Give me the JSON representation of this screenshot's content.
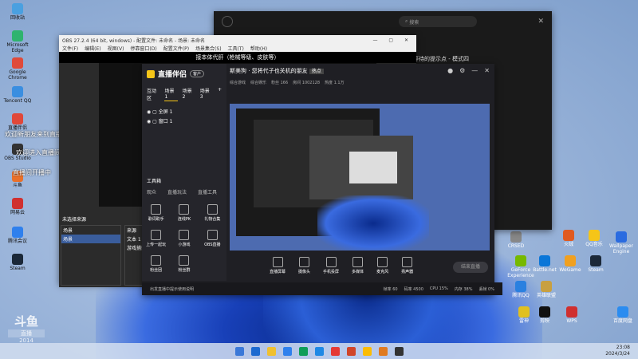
{
  "desktop": {
    "left_icons": [
      {
        "label": "回收站",
        "color": "#4aa0e0"
      },
      {
        "label": "Microsoft Edge",
        "color": "#2fb36f"
      },
      {
        "label": "Google Chrome",
        "color": "#e04a3a"
      },
      {
        "label": "Tencent QQ",
        "color": "#3a8ee0"
      },
      {
        "label": "直播伴侣",
        "color": "#e0483a"
      },
      {
        "label": "OBS Studio",
        "color": "#333333"
      },
      {
        "label": "斗鱼",
        "color": "#e8702a"
      },
      {
        "label": "网易云",
        "color": "#d03030"
      },
      {
        "label": "腾讯会议",
        "color": "#2f80ed"
      },
      {
        "label": "Steam",
        "color": "#1b2838"
      }
    ],
    "overlay_lines": [
      "欢迎新朋友来到直播间",
      "欢迎进入直播间和礼物消息",
      "直播间开播中"
    ],
    "right_icons": [
      {
        "label": "CRSED",
        "color": "#888"
      },
      {
        "label": "GeForce Experience",
        "color": "#76b900"
      },
      {
        "label": "Battle.net",
        "color": "#0a76d8"
      },
      {
        "label": "WeGame",
        "color": "#f0a020"
      },
      {
        "label": "Steam",
        "color": "#1b2838"
      },
      {
        "label": "Wallpaper Engine",
        "color": "#2a6be0"
      },
      {
        "label": "QQ音乐",
        "color": "#f5c518"
      },
      {
        "label": "火绒",
        "color": "#e05a20"
      },
      {
        "label": "WPS",
        "color": "#d02f2f"
      },
      {
        "label": "雷神",
        "color": "#e0c020"
      },
      {
        "label": "腾讯QQ",
        "color": "#2a80e0"
      },
      {
        "label": "英雄联盟",
        "color": "#c8a040"
      },
      {
        "label": "剪映",
        "color": "#111"
      },
      {
        "label": "百度网盘",
        "color": "#2b8cf0"
      }
    ],
    "watermark": {
      "brand": "斗鱼",
      "sub": "直播",
      "room": "2014"
    }
  },
  "obs": {
    "title": "OBS 27.2.4 (64 bit, windows) - 配置文件: 未命名 - 场景: 未命名",
    "menus": [
      "文件(F)",
      "编辑(E)",
      "视图(V)",
      "停靠窗口(D)",
      "配置文件(P)",
      "场景集合(S)",
      "工具(T)",
      "帮助(H)"
    ],
    "banner": "接本体代肝（枪械等级、皮肤等）",
    "scene_panel": "场景",
    "sources_panel": "来源",
    "scene_item": "场景",
    "source_items": [
      "文本 1",
      "游戏捕获"
    ],
    "no_source": "未选择来源"
  },
  "dark_window": {
    "search_placeholder": "搜索",
    "subtitle": "等待的提示点 - 模式四"
  },
  "zhibo": {
    "brand": "直播伴侣",
    "badge": "客户",
    "tabs": [
      "互动区",
      "场景 1",
      "场景 2",
      "场景 3"
    ],
    "items": [
      "全屏 1",
      "窗口 1"
    ],
    "tool_title": "工具箱",
    "tool_tabs": [
      "观众",
      "直播玩法",
      "直播工具"
    ],
    "tools": [
      "歌词助手",
      "连线PK",
      "礼物合集",
      "上传一起玩",
      "小游戏",
      "OBS直播",
      "粉丝团",
      "粉丝群"
    ],
    "room_title": "斯美狗 · 您将代子也关机的朋友",
    "room_tag": "热点",
    "room_stats": [
      "综合游戏",
      "综合娱乐",
      "粉丝 166",
      "房间 1002128",
      "热度 1.1万"
    ],
    "bottom_controls": [
      "直播屏幕",
      "摄像头",
      "手机投屏",
      "多媒体",
      "麦克风",
      "扬声器"
    ],
    "go_live": "结束直播",
    "status": "出发直播中提示使用说明",
    "status_stats": [
      "帧率 60",
      "码率 4500",
      "CPU 15%",
      "内存 38%",
      "丢帧 0%"
    ]
  },
  "taskbar": {
    "icons": [
      "#3a78d8",
      "#1d6ad0",
      "#f0c030",
      "#2f80ed",
      "#0f9d58",
      "#1e88e5",
      "#e53935",
      "#d0452a",
      "#fbbc05",
      "#e07a20",
      "#333333"
    ],
    "time": "23:08",
    "date": "2024/3/24"
  }
}
